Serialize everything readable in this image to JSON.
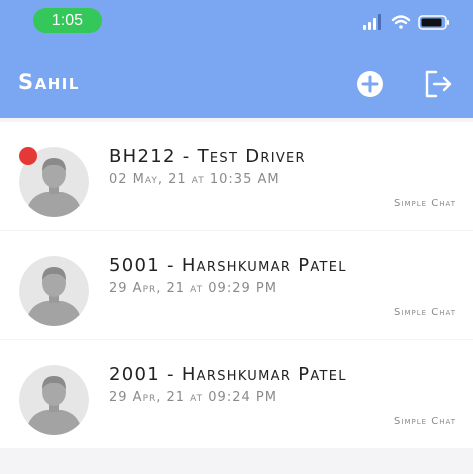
{
  "status_bar": {
    "time": "1:05",
    "signal_icon": "signal-icon",
    "wifi_icon": "wifi-icon",
    "battery_icon": "battery-icon"
  },
  "nav": {
    "title": "Sahil",
    "add_icon": "add-circle-icon",
    "logout_icon": "logout-icon"
  },
  "chats": [
    {
      "title": "BH212 - Test Driver",
      "date": "02 May, 21 at 10:35 AM",
      "tag": "Simple Chat",
      "unread": true
    },
    {
      "title": "5001 - Harshkumar Patel",
      "date": "29 Apr, 21 at 09:29 PM",
      "tag": "Simple Chat",
      "unread": false
    },
    {
      "title": "2001 - Harshkumar Patel",
      "date": "29 Apr, 21 at 09:24 PM",
      "tag": "Simple Chat",
      "unread": false
    }
  ],
  "colors": {
    "header": "#7aa6f2",
    "time_pill": "#34c759",
    "unread_dot": "#e53935"
  }
}
